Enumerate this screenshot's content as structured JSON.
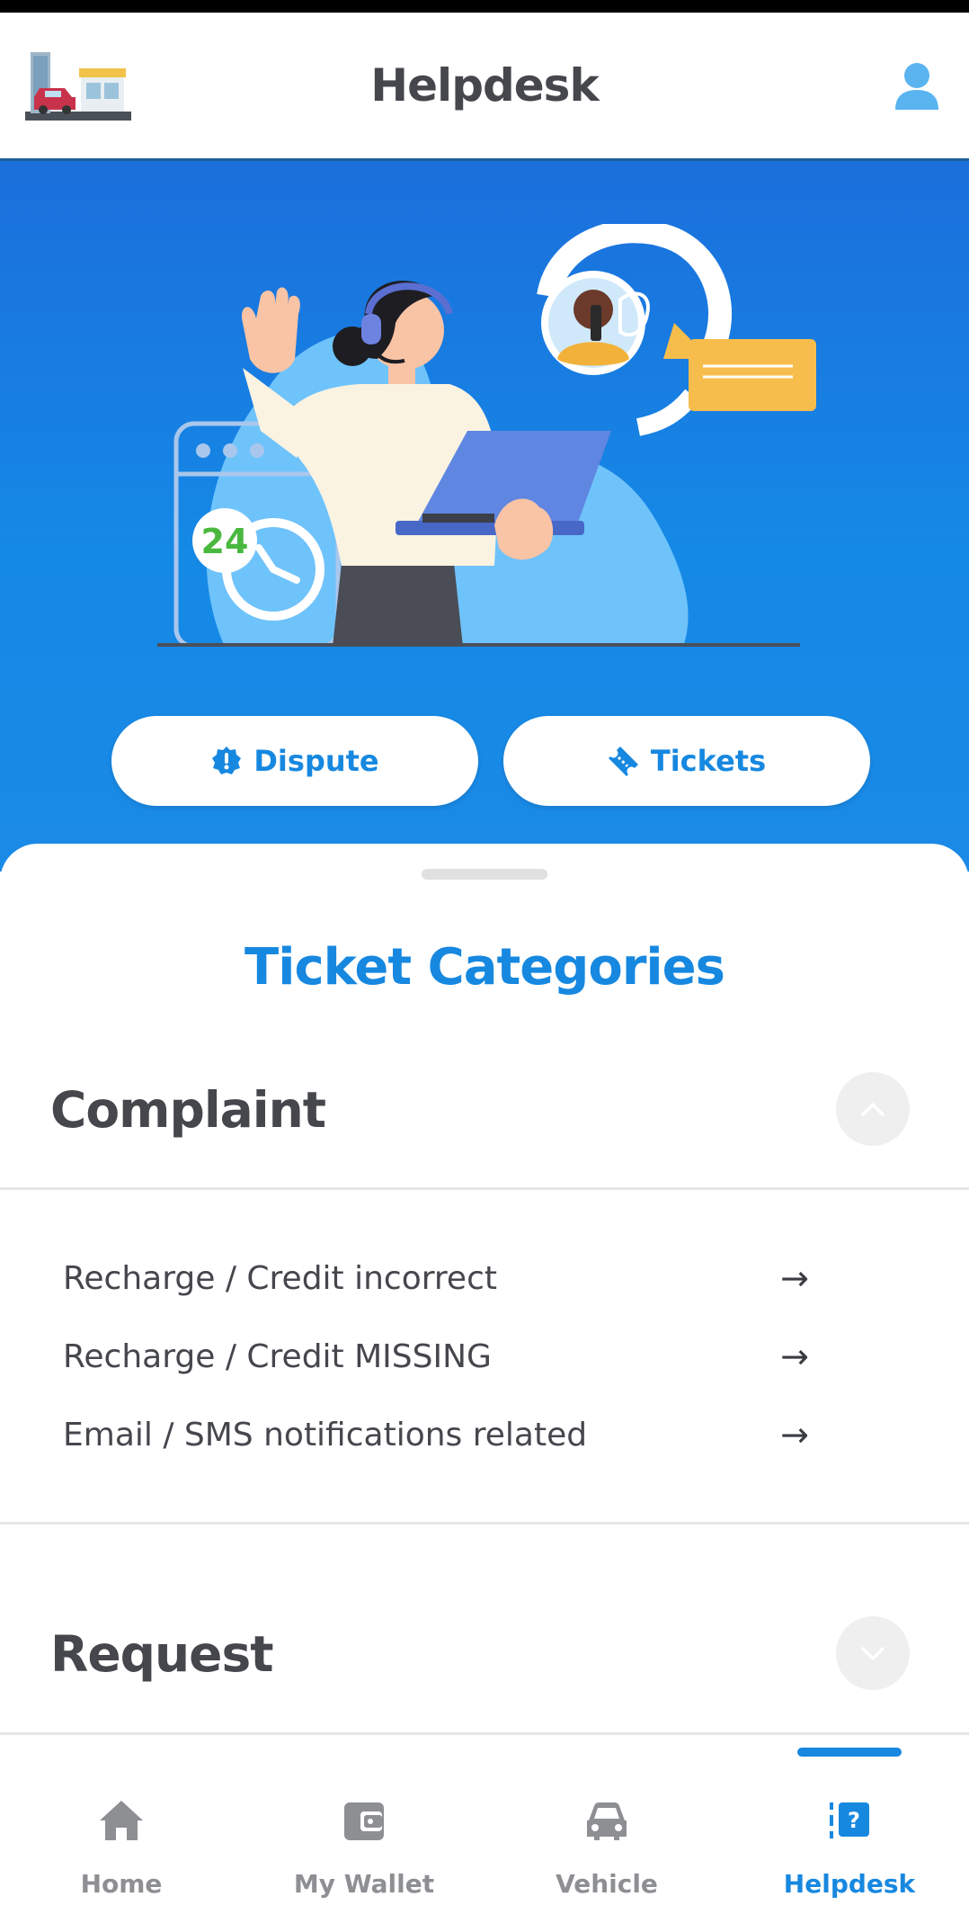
{
  "app": {
    "title": "Helpdesk"
  },
  "hero": {
    "clock_badge": "24",
    "buttons": [
      {
        "label": "Dispute",
        "icon": "alert-badge-icon"
      },
      {
        "label": "Tickets",
        "icon": "ticket-icon"
      }
    ]
  },
  "sheet": {
    "title": "Ticket Categories",
    "sections": [
      {
        "name": "Complaint",
        "expanded": true,
        "items": [
          "Recharge / Credit incorrect",
          "Recharge / Credit MISSING",
          "Email / SMS notifications related"
        ]
      },
      {
        "name": "Request",
        "expanded": false
      }
    ],
    "item_arrow": "→"
  },
  "bottom_nav": {
    "items": [
      {
        "label": "Home",
        "icon": "home-icon"
      },
      {
        "label": "My Wallet",
        "icon": "wallet-icon"
      },
      {
        "label": "Vehicle",
        "icon": "car-icon"
      },
      {
        "label": "Helpdesk",
        "icon": "help-icon"
      }
    ],
    "active": "Helpdesk"
  },
  "colors": {
    "accent": "#1788e0",
    "hero_top": "#1b6fdc",
    "text": "#45474d",
    "inactive": "#8d8f93"
  }
}
